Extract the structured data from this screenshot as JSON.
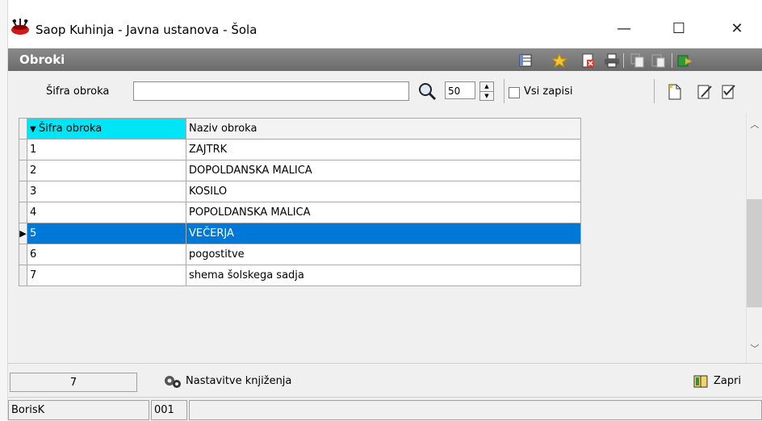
{
  "window": {
    "title": "Saop Kuhinja - Javna ustanova - Šola",
    "minimize_symbol": "—",
    "maximize_symbol": "☐",
    "close_symbol": "✕"
  },
  "section": {
    "title": "Obroki",
    "header_icons": [
      "columns-icon",
      "star-icon",
      "delete-doc-icon",
      "printer-icon",
      "copy-icon",
      "paste-icon",
      "book-arrow-icon"
    ]
  },
  "toolbar": {
    "filter_label": "Šifra obroka",
    "filter_value": "",
    "record_count": "50",
    "all_records_label": "Vsi zapisi",
    "all_records_checked": false,
    "right_icons": [
      "new-document-icon",
      "edit-document-icon",
      "edit-check-icon"
    ]
  },
  "grid": {
    "columns": [
      {
        "label": "Šifra obroka",
        "sorted": true
      },
      {
        "label": "Naziv obroka",
        "sorted": false
      }
    ],
    "rows": [
      {
        "code": "1",
        "name": "ZAJTRK"
      },
      {
        "code": "2",
        "name": "DOPOLDANSKA MALICA"
      },
      {
        "code": "3",
        "name": "KOSILO"
      },
      {
        "code": "4",
        "name": "POPOLDANSKA MALICA"
      },
      {
        "code": "5",
        "name": "VEČERJA"
      },
      {
        "code": "6",
        "name": "pogostitve"
      },
      {
        "code": "7",
        "name": "shema šolskega sadja"
      }
    ],
    "selected_row": 4,
    "selected_color": "#0078d7",
    "sort_header_color": "#00e5f5"
  },
  "footer": {
    "count": "7",
    "posting_settings_label": "Nastavitve knjiženja",
    "close_label": "Zapri"
  },
  "status": {
    "user": "BorisK",
    "code": "001",
    "message": ""
  }
}
